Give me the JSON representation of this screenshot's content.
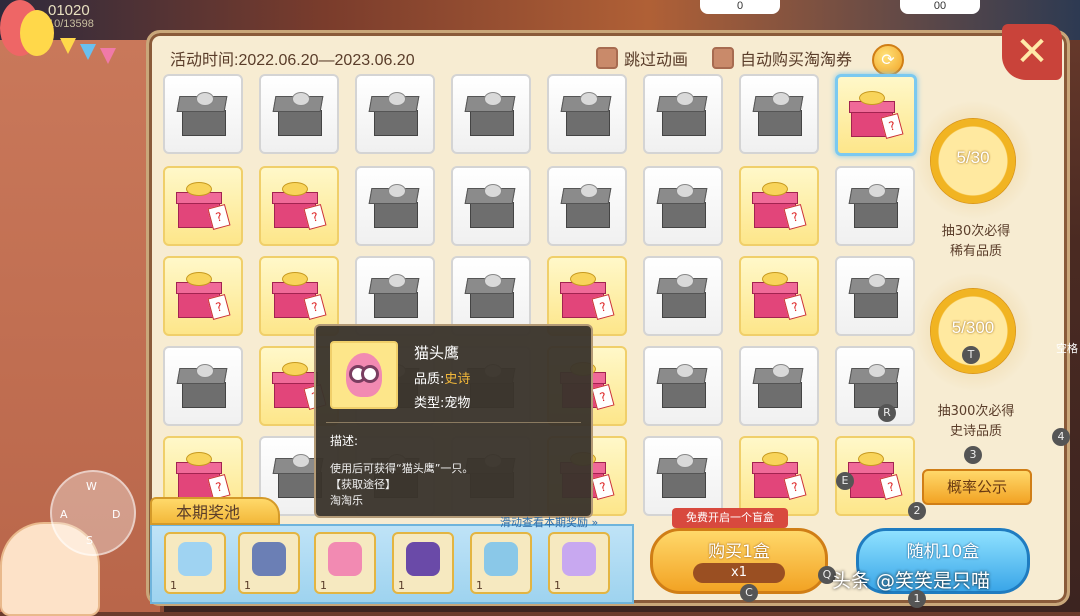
{
  "hud": {
    "coins_text": "01020",
    "progress_text": "10/13598",
    "pill_1": "0",
    "pill_2": "00"
  },
  "header": {
    "activity_time": "活动时间:2022.06.20—2023.06.20",
    "skip_animation": "跳过动画",
    "auto_buy": "自动购买淘淘券",
    "refresh_icon": "refresh-icon",
    "close_icon": "close-icon"
  },
  "grid": {
    "rows": [
      [
        "grey",
        "grey",
        "grey",
        "grey",
        "grey",
        "grey",
        "grey",
        "gold-selected"
      ],
      [
        "gold",
        "gold",
        "grey",
        "grey",
        "grey",
        "grey",
        "gold",
        "grey"
      ],
      [
        "gold",
        "gold",
        "grey",
        "grey",
        "gold",
        "grey",
        "gold",
        "grey"
      ],
      [
        "grey",
        "gold",
        "grey",
        "grey",
        "gold",
        "grey",
        "grey",
        "grey"
      ],
      [
        "gold",
        "grey",
        "grey",
        "grey",
        "gold",
        "grey",
        "gold",
        "gold"
      ]
    ]
  },
  "tooltip": {
    "name": "猫头鹰",
    "quality_label": "品质:",
    "quality_value": "史诗",
    "type_label": "类型:",
    "type_value": "宠物",
    "desc_title": "描述:",
    "desc_line1": "使用后可获得“猫头鹰”一只。",
    "desc_line2": "【获取途径】",
    "desc_line3": "淘淘乐"
  },
  "side": {
    "progress1": "5/30",
    "progress1_text1": "抽30次必得",
    "progress1_text2": "稀有品质",
    "progress2": "5/300",
    "progress2_text1": "抽300次必得",
    "progress2_text2": "史诗品质",
    "rate_button": "概率公示"
  },
  "pool": {
    "title": "本期奖池",
    "hint": "滑动查看本期奖励 »",
    "items": [
      {
        "count": "1",
        "color": "#9fd3f2"
      },
      {
        "count": "1",
        "color": "#6b7fb5"
      },
      {
        "count": "1",
        "color": "#f28ab2"
      },
      {
        "count": "1",
        "color": "#6a4aa8"
      },
      {
        "count": "1",
        "color": "#8ac8e8"
      },
      {
        "count": "1",
        "color": "#c8a8f0"
      }
    ]
  },
  "actions": {
    "free_tag": "免费开启一个盲盒",
    "buy_label": "购买1盒",
    "buy_qty": "x1",
    "random_label": "随机10盒"
  },
  "overlay": {
    "watermark": "头条 @笑笑是只喵",
    "keys": [
      "R",
      "T",
      "3",
      "2",
      "E",
      "4",
      "Q",
      "C",
      "1",
      "W",
      "A",
      "S",
      "D",
      "空格"
    ]
  },
  "colors": {
    "panel_bg": "#f7ecd2",
    "accent_gold": "#f2a324",
    "accent_blue": "#3aa6e8",
    "close_red": "#c9433a"
  }
}
